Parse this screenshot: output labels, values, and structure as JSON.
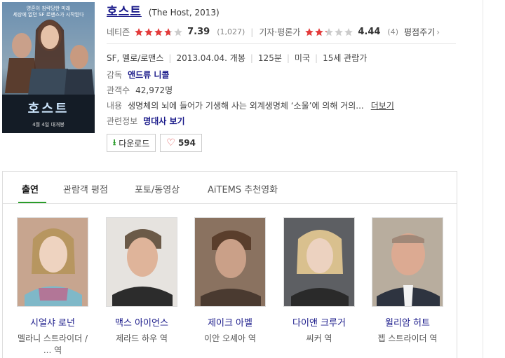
{
  "movie": {
    "title": "호스트",
    "title_en": "(The Host, 2013)",
    "poster_title": "호스트",
    "poster_tagline_1": "영혼이 침략당한 미래",
    "poster_tagline_2": "세상에 없던 SF 로맨스가 시작된다",
    "poster_date": "4월 4일 대개봉"
  },
  "ratings": {
    "netizen_label": "네티즌",
    "netizen_score": "7.39",
    "netizen_count": "(1,027)",
    "netizen_stars": 3.7,
    "critic_label": "기자·평론가",
    "critic_score": "4.44",
    "critic_count": "(4)",
    "critic_stars": 2.2,
    "review_link": "평점주기"
  },
  "details": {
    "genre": "SF, 멜로/로맨스",
    "release": "2013.04.04. 개봉",
    "runtime": "125분",
    "country": "미국",
    "age": "15세 관람가",
    "director_label": "감독",
    "director": "앤드류 니콜",
    "audience_label": "관객수",
    "audience": "42,972명",
    "plot_label": "내용",
    "plot": "생명체의 뇌에 들어가 기생해 사는 외계생명체 ‘소울’에 의해 거의...",
    "more_link": "더보기",
    "related_label": "관련정보",
    "related": "명대사 보기"
  },
  "buttons": {
    "download": "다운로드",
    "likes": "594"
  },
  "tabs": [
    "출연",
    "관람객 평점",
    "포토/동영상",
    "AiTEMS 추천영화"
  ],
  "cast": [
    {
      "name": "시얼샤 로넌",
      "role": "멜라니 스트라이더 / ... 역"
    },
    {
      "name": "맥스 아이언스",
      "role": "제라드 하우 역"
    },
    {
      "name": "제이크 아벨",
      "role": "이안 오셰아 역"
    },
    {
      "name": "다이앤 크루거",
      "role": "씨커 역"
    },
    {
      "name": "윌리암 허트",
      "role": "젭 스트라이더 역"
    }
  ],
  "colors": {
    "link": "#1a1a8a",
    "star": "#e33b3b",
    "accent": "#2a9d2a"
  }
}
